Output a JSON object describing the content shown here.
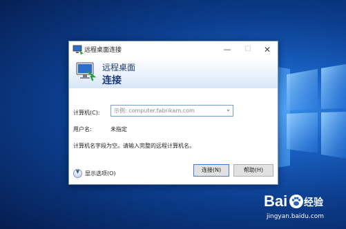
{
  "dialog": {
    "title": "远程桌面连接",
    "controls": {
      "minimize": "—",
      "maximize": "☐",
      "close": "✕"
    },
    "banner": {
      "subtitle": "远程桌面",
      "title": "连接"
    },
    "form": {
      "computer_label": "计算机(C):",
      "computer_placeholder": "示例: computer.fabrikam.com",
      "username_label": "用户名:",
      "username_value": "未指定",
      "hint": "计算机名字段为空。请输入完整的远程计算机名。"
    },
    "show_options": "显示选项(O)",
    "buttons": {
      "connect": "连接(N)",
      "help": "帮助(H)"
    }
  },
  "watermark": {
    "logo_left": "Bai",
    "logo_right": "经验",
    "url": "jingyan.baidu.com"
  },
  "colors": {
    "desktop_blue": "#0c3d8d",
    "banner_text": "#1c3a78",
    "accent_border": "#3d7bd2"
  }
}
